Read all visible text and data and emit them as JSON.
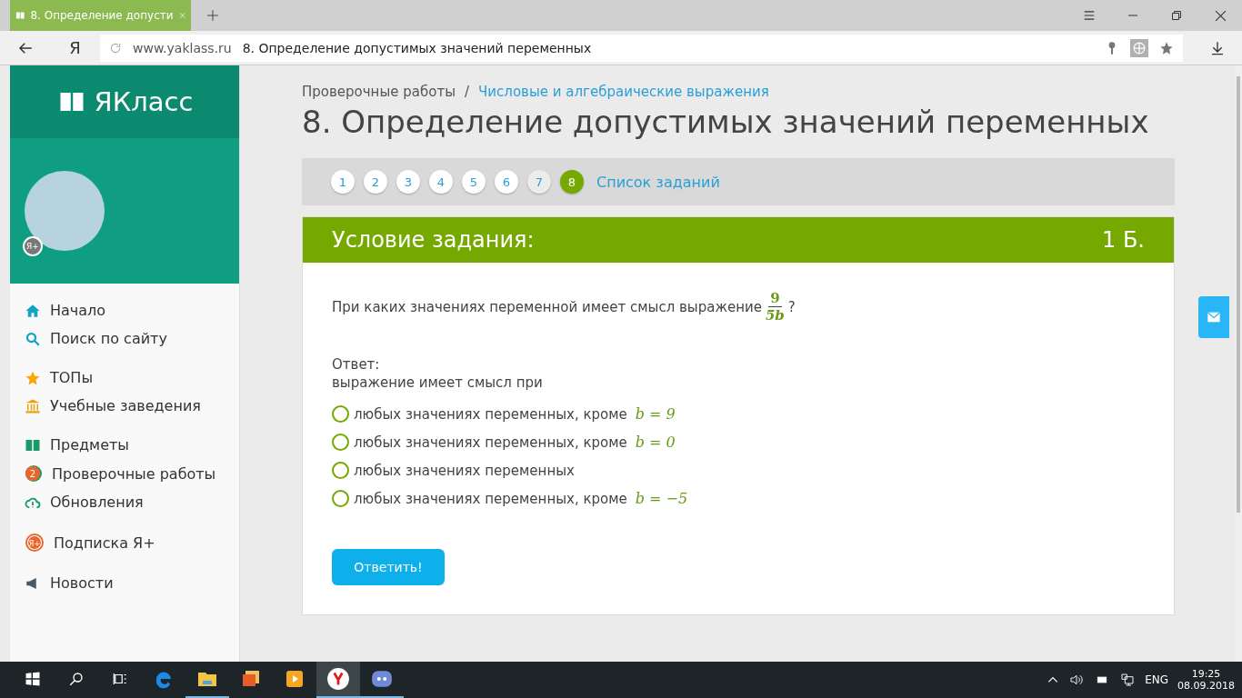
{
  "browser": {
    "tab_title": "8. Определение допусти",
    "logo_letter": "Я",
    "url_host": "www.yaklass.ru",
    "url_title": "8. Определение допустимых значений переменных"
  },
  "sidebar": {
    "brand": "ЯКласс",
    "badge": "Я+",
    "groups": [
      [
        {
          "kind": "home",
          "label": "Начало"
        },
        {
          "kind": "search",
          "label": "Поиск по сайту"
        }
      ],
      [
        {
          "kind": "star",
          "label": "ТОПы"
        },
        {
          "kind": "school",
          "label": "Учебные заведения"
        }
      ],
      [
        {
          "kind": "book",
          "label": "Предметы"
        },
        {
          "kind": "tests",
          "label": "Проверочные работы",
          "count": "2"
        },
        {
          "kind": "cloud",
          "label": "Обновления"
        }
      ],
      [
        {
          "kind": "plus",
          "label": "Подписка Я+",
          "mark": "Я+"
        }
      ],
      [
        {
          "kind": "news",
          "label": "Новости"
        }
      ]
    ]
  },
  "breadcrumbs": [
    {
      "label": "Проверочные работы",
      "link": false
    },
    {
      "separator": "/",
      "label": "Числовые и алгебраические выражения",
      "link": true
    }
  ],
  "title": "8. Определение допустимых значений переменных",
  "pager": {
    "pages": [
      {
        "label": "1",
        "selected": false,
        "dimmed": false
      },
      {
        "label": "2",
        "selected": false,
        "dimmed": false
      },
      {
        "label": "3",
        "selected": false,
        "dimmed": false
      },
      {
        "label": "4",
        "selected": false,
        "dimmed": false
      },
      {
        "label": "5",
        "selected": false,
        "dimmed": false
      },
      {
        "label": "6",
        "selected": false,
        "dimmed": false
      },
      {
        "label": "7",
        "selected": false,
        "dimmed": true
      },
      {
        "label": "8",
        "selected": true,
        "dimmed": false
      }
    ],
    "list_link": "Список заданий"
  },
  "task": {
    "header": "Условие задания:",
    "points": "1 Б.",
    "question": "При каких значениях переменной имеет смысл выражение",
    "numerator": "9",
    "denominator": "5b",
    "suffix": "?",
    "answer_label": "Ответ:",
    "answer_lead": "выражение имеет смысл при",
    "options": [
      {
        "label": "любых значениях переменных, кроме",
        "math": "b = 9",
        "selected": false
      },
      {
        "label": "любых значениях переменных, кроме",
        "math": "b = 0",
        "selected": false
      },
      {
        "label": "любых значениях переменных",
        "selected": false
      },
      {
        "label": "любых значениях переменных, кроме",
        "math": "b = −5",
        "selected": false
      }
    ],
    "submit": "Ответить!"
  },
  "taskbar": {
    "apps": [
      {
        "kind": "edge",
        "running": false,
        "active": false
      },
      {
        "kind": "folder",
        "running": true,
        "active": false
      },
      {
        "kind": "photos",
        "running": false,
        "active": false
      },
      {
        "kind": "player",
        "running": false,
        "active": false
      },
      {
        "kind": "yandex",
        "running": true,
        "active": true
      },
      {
        "kind": "discord",
        "running": true,
        "active": false
      }
    ],
    "language": "ENG",
    "time": "19:25",
    "date": "08.09.2018"
  }
}
